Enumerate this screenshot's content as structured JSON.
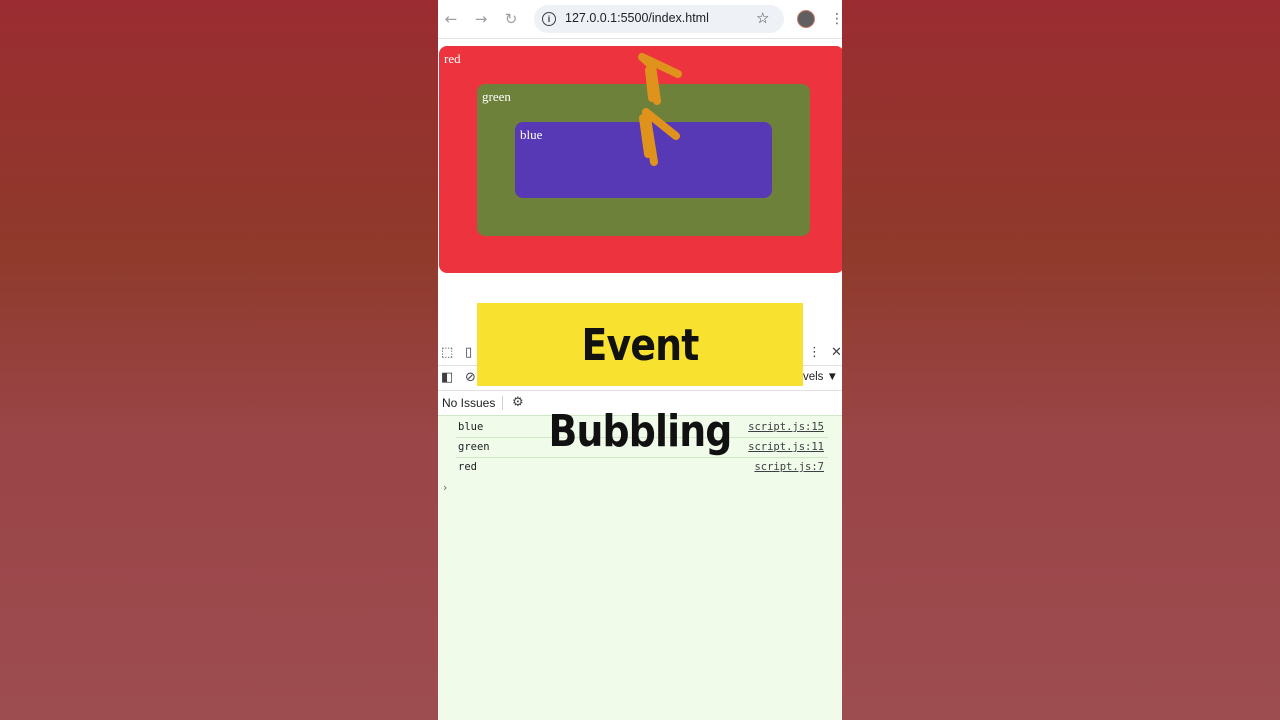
{
  "browser": {
    "url": "127.0.0.1:5500/index.html",
    "icons": {
      "back": "arrow-left-icon",
      "forward": "arrow-right-icon",
      "reload": "reload-icon",
      "site_info": "info-icon",
      "bookmark": "star-icon",
      "profile": "avatar",
      "menu": "kebab-menu-icon"
    }
  },
  "page": {
    "boxes": [
      {
        "label": "red",
        "color": "#ed333d"
      },
      {
        "label": "green",
        "color": "#6d813b"
      },
      {
        "label": "blue",
        "color": "#5738b5"
      }
    ],
    "annotation_color": "#e0931c"
  },
  "devtools": {
    "levels_label": "evels ▼",
    "issues_label": "No Issues",
    "logs": [
      {
        "message": "blue",
        "source": "script.js:15"
      },
      {
        "message": "green",
        "source": "script.js:11"
      },
      {
        "message": "red",
        "source": "script.js:7"
      }
    ],
    "prompt": "›",
    "close_glyph": "✕",
    "more_glyph": "⋮"
  },
  "overlay": {
    "title": "Event Bubbling",
    "background": "#f9e12f"
  }
}
